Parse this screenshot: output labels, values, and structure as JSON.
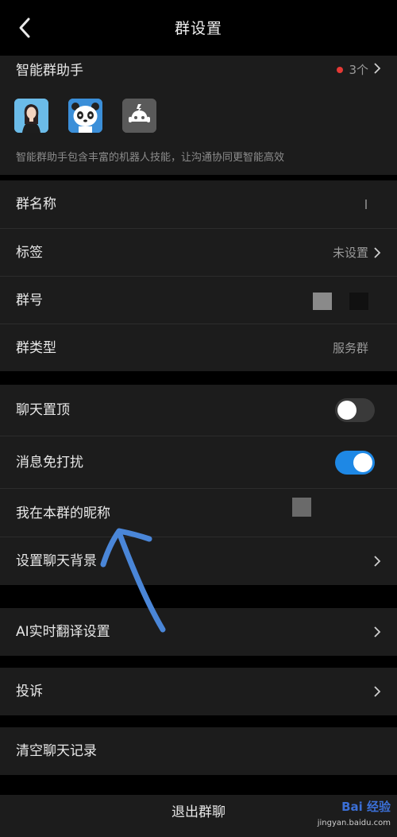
{
  "header": {
    "title": "群设置",
    "back_icon": "chevron-left-icon"
  },
  "assistant": {
    "label": "智能群助手",
    "count": "3个",
    "description": "智能群助手包含丰富的机器人技能，让沟通协同更智能高效",
    "bots": [
      "woman-avatar-icon",
      "panda-avatar-icon",
      "robot-avatar-icon"
    ]
  },
  "group_info": {
    "name_label": "群名称",
    "tag_label": "标签",
    "tag_value": "未设置",
    "number_label": "群号",
    "type_label": "群类型",
    "type_value": "服务群"
  },
  "chat_settings": {
    "pin_label": "聊天置顶",
    "pin_on": false,
    "mute_label": "消息免打扰",
    "mute_on": true,
    "nickname_label": "我在本群的昵称",
    "background_label": "设置聊天背景"
  },
  "translate": {
    "label": "AI实时翻译设置"
  },
  "complaint": {
    "label": "投诉"
  },
  "clear": {
    "label": "清空聊天记录"
  },
  "exit": {
    "label": "退出群聊"
  },
  "watermark": {
    "text": "Bai 经验",
    "url": "jingyan.baidu.com"
  },
  "colors": {
    "toggle_on": "#1e88e5",
    "badge_dot": "#e53935",
    "annotation_arrow": "#4a86d8"
  }
}
